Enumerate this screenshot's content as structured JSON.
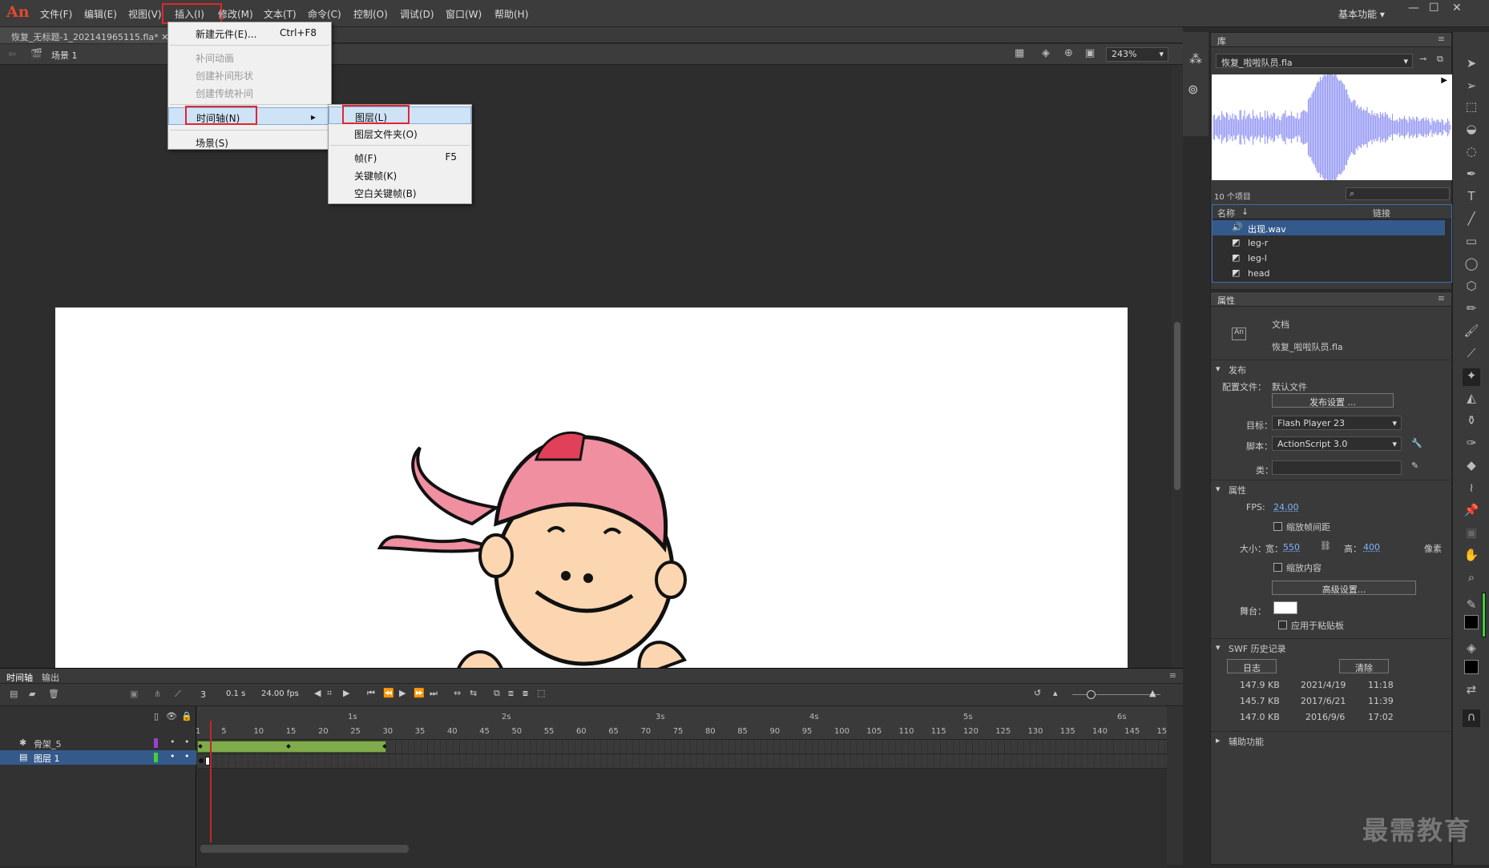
{
  "app": {
    "logo": "An",
    "workspace": "基本功能",
    "workspace_arrow": "▾"
  },
  "menu": [
    "文件(F)",
    "编辑(E)",
    "视图(V)",
    "插入(I)",
    "修改(M)",
    "文本(T)",
    "命令(C)",
    "控制(O)",
    "调试(D)",
    "窗口(W)",
    "帮助(H)"
  ],
  "window_controls": {
    "minimize": "—",
    "maximize": "☐",
    "close": "✕"
  },
  "document": {
    "tab": "恢复_无标题-1_202141965115.fla*",
    "tab_close": "✕",
    "scene": "场景 1",
    "zoom": "243%"
  },
  "insert_menu": {
    "items": [
      {
        "label": "新建元件(E)...",
        "shortcut": "Ctrl+F8",
        "disabled": false
      },
      {
        "label": "补间动画",
        "disabled": true
      },
      {
        "label": "创建补间形状",
        "disabled": true
      },
      {
        "label": "创建传统补间",
        "disabled": true
      },
      {
        "label": "时间轴(N)",
        "submenu": true
      },
      {
        "label": "场景(S)"
      }
    ]
  },
  "timeline_submenu": {
    "items": [
      {
        "label": "图层(L)"
      },
      {
        "label": "图层文件夹(O)"
      },
      {
        "label": "帧(F)",
        "shortcut": "F5"
      },
      {
        "label": "关键帧(K)"
      },
      {
        "label": "空白关键帧(B)"
      }
    ]
  },
  "timeline": {
    "tabs": [
      "时间轴",
      "输出"
    ],
    "current_frame": "3",
    "time": "0.1 s",
    "fps": "24.00 fps",
    "seconds": [
      "1s",
      "2s",
      "3s",
      "4s",
      "5s",
      "6s"
    ],
    "ticks": [
      "1",
      "5",
      "10",
      "15",
      "20",
      "25",
      "30",
      "35",
      "40",
      "45",
      "50",
      "55",
      "60",
      "65",
      "70",
      "75",
      "80",
      "85",
      "90",
      "95",
      "100",
      "105",
      "110",
      "115",
      "120",
      "125",
      "130",
      "135",
      "140",
      "145",
      "15"
    ],
    "layers": [
      {
        "name": "骨架_5",
        "color": "#9b3fd1"
      },
      {
        "name": "图层 1",
        "color": "#3fd13f"
      }
    ]
  },
  "library": {
    "title": "库",
    "file": "恢复_啦啦队员.fla",
    "count": "10 个项目",
    "col_name": "名称",
    "col_link": "链接",
    "items": [
      "出现.wav",
      "leg-r",
      "leg-l",
      "head"
    ]
  },
  "properties": {
    "title": "属性",
    "doc_label": "文档",
    "doc_name": "恢复_啦啦队员.fla",
    "publish_header": "发布",
    "profile_label": "配置文件：",
    "profile_value": "默认文件",
    "publish_settings": "发布设置 ...",
    "target_label": "目标：",
    "target_value": "Flash Player 23",
    "script_label": "脚本：",
    "script_value": "ActionScript 3.0",
    "class_label": "类：",
    "attr_header": "属性",
    "fps_label": "FPS:",
    "fps_value": "24.00",
    "scale_spans": "缩放帧间距",
    "size_label": "大小：",
    "width_label": "宽：",
    "width_value": "550",
    "height_label": "高：",
    "height_value": "400",
    "unit": "像素",
    "scale_content": "缩放内容",
    "advanced": "高级设置...",
    "stage_label": "舞台：",
    "apply_paste": "应用于粘贴板",
    "swf_header": "SWF 历史记录",
    "log_btn": "日志",
    "clear_btn": "清除",
    "history": [
      {
        "size": "147.9 KB",
        "date": "2021/4/19",
        "time": "11:18"
      },
      {
        "size": "145.7 KB",
        "date": "2017/6/21",
        "time": "11:39"
      },
      {
        "size": "147.0 KB",
        "date": "2016/9/6",
        "time": "17:02"
      }
    ],
    "access_header": "辅助功能"
  },
  "watermark": "最需教育",
  "colors": {
    "accent_red": "#e0262d",
    "waveform": "#9a9cf5",
    "hair_pink": "#f08fa0",
    "skin": "#fcd6b0"
  }
}
